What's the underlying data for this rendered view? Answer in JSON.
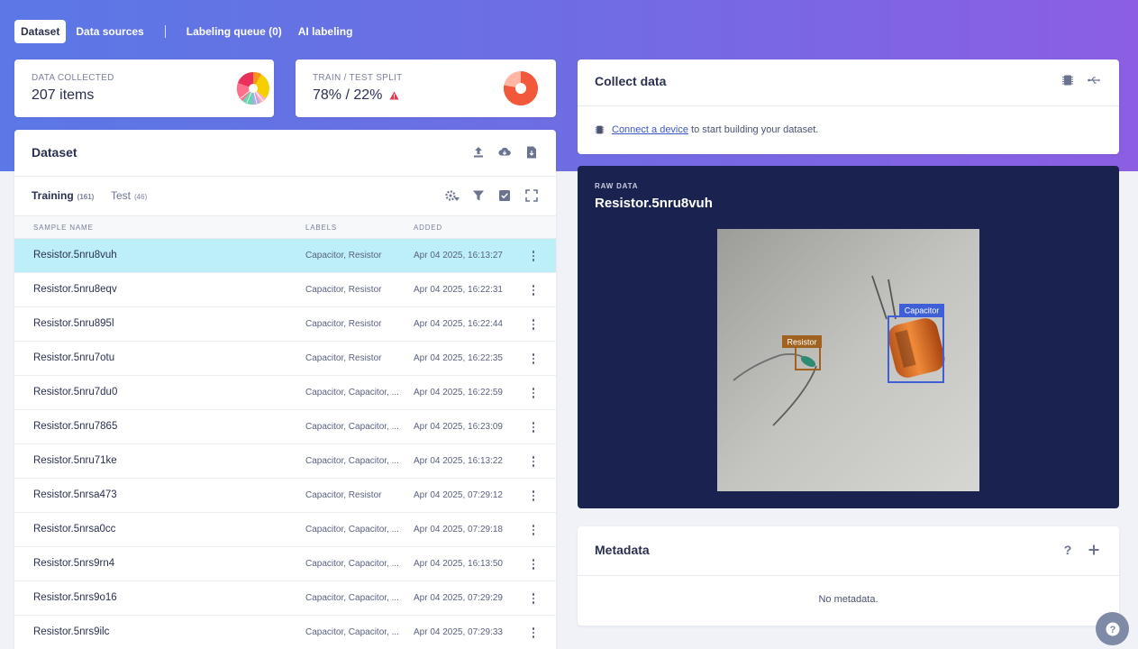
{
  "nav": {
    "tabs": [
      {
        "label": "Dataset"
      },
      {
        "label": "Data sources"
      },
      {
        "label": "Labeling queue (0)"
      },
      {
        "label": "AI labeling"
      }
    ]
  },
  "stats": {
    "collected": {
      "label": "DATA COLLECTED",
      "value": "207 items"
    },
    "split": {
      "label": "TRAIN / TEST SPLIT",
      "value": "78% / 22%",
      "train_fraction": 0.78
    }
  },
  "dataset": {
    "title": "Dataset",
    "tabs": [
      {
        "label": "Training",
        "count": "(161)"
      },
      {
        "label": "Test",
        "count": "(46)"
      }
    ],
    "columns": [
      "SAMPLE NAME",
      "LABELS",
      "ADDED"
    ],
    "rows": [
      {
        "name": "Resistor.5nru8vuh",
        "labels": "Capacitor, Resistor",
        "added": "Apr 04 2025, 16:13:27"
      },
      {
        "name": "Resistor.5nru8eqv",
        "labels": "Capacitor, Resistor",
        "added": "Apr 04 2025, 16:22:31"
      },
      {
        "name": "Resistor.5nru895l",
        "labels": "Capacitor, Resistor",
        "added": "Apr 04 2025, 16:22:44"
      },
      {
        "name": "Resistor.5nru7otu",
        "labels": "Capacitor, Resistor",
        "added": "Apr 04 2025, 16:22:35"
      },
      {
        "name": "Resistor.5nru7du0",
        "labels": "Capacitor, Capacitor, ...",
        "added": "Apr 04 2025, 16:22:59"
      },
      {
        "name": "Resistor.5nru7865",
        "labels": "Capacitor, Capacitor, ...",
        "added": "Apr 04 2025, 16:23:09"
      },
      {
        "name": "Resistor.5nru71ke",
        "labels": "Capacitor, Capacitor, ...",
        "added": "Apr 04 2025, 16:13:22"
      },
      {
        "name": "Resistor.5nrsa473",
        "labels": "Capacitor, Resistor",
        "added": "Apr 04 2025, 07:29:12"
      },
      {
        "name": "Resistor.5nrsa0cc",
        "labels": "Capacitor, Capacitor, ...",
        "added": "Apr 04 2025, 07:29:18"
      },
      {
        "name": "Resistor.5nrs9rn4",
        "labels": "Capacitor, Capacitor, ...",
        "added": "Apr 04 2025, 16:13:50"
      },
      {
        "name": "Resistor.5nrs9o16",
        "labels": "Capacitor, Capacitor, ...",
        "added": "Apr 04 2025, 07:29:29"
      },
      {
        "name": "Resistor.5nrs9ilc",
        "labels": "Capacitor, Capacitor, ...",
        "added": "Apr 04 2025, 07:29:33"
      }
    ]
  },
  "collect": {
    "title": "Collect data",
    "link": "Connect a device",
    "rest": " to start building your dataset."
  },
  "raw": {
    "kicker": "RAW DATA",
    "title": "Resistor.5nru8vuh",
    "boxes": [
      {
        "label": "Resistor",
        "color": "#a0621e"
      },
      {
        "label": "Capacitor",
        "color": "#3f5fd8"
      }
    ]
  },
  "metadata": {
    "title": "Metadata",
    "empty": "No metadata."
  },
  "colors": {
    "selected_row": "#bdeff8",
    "raw_bg": "#1a2350",
    "split_train": "#f2583a",
    "warning": "#e0344f"
  }
}
